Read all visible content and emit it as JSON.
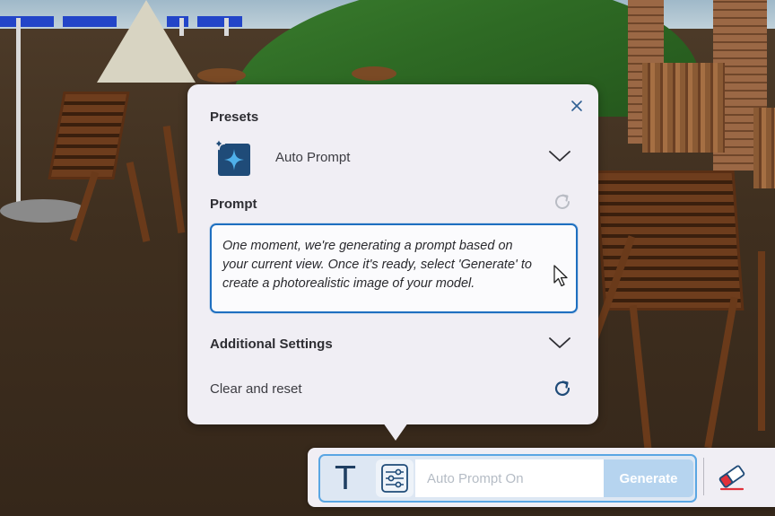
{
  "panel": {
    "presets_title": "Presets",
    "preset_selected": "Auto Prompt",
    "prompt_title": "Prompt",
    "prompt_text": "One moment, we're generating a prompt based on your current view. Once it's ready, select 'Generate' to create a photorealistic image of your model.",
    "additional_settings": "Additional Settings",
    "clear_reset": "Clear and reset",
    "icons": {
      "close": "close-icon",
      "preset": "sparkle-icon",
      "dropdown": "chevron-down-icon",
      "refresh": "refresh-icon",
      "cursor": "mouse-pointer-icon"
    }
  },
  "toolbar": {
    "text_tool_label": "T",
    "input_placeholder": "Auto Prompt On",
    "generate_label": "Generate",
    "icons": {
      "settings": "sliders-icon",
      "eraser": "eraser-icon"
    }
  },
  "colors": {
    "accent": "#1e6fc0",
    "generate_bg": "#b6d4ef",
    "panel_bg": "#f0eef4",
    "icon_navy": "#1f4b78"
  }
}
